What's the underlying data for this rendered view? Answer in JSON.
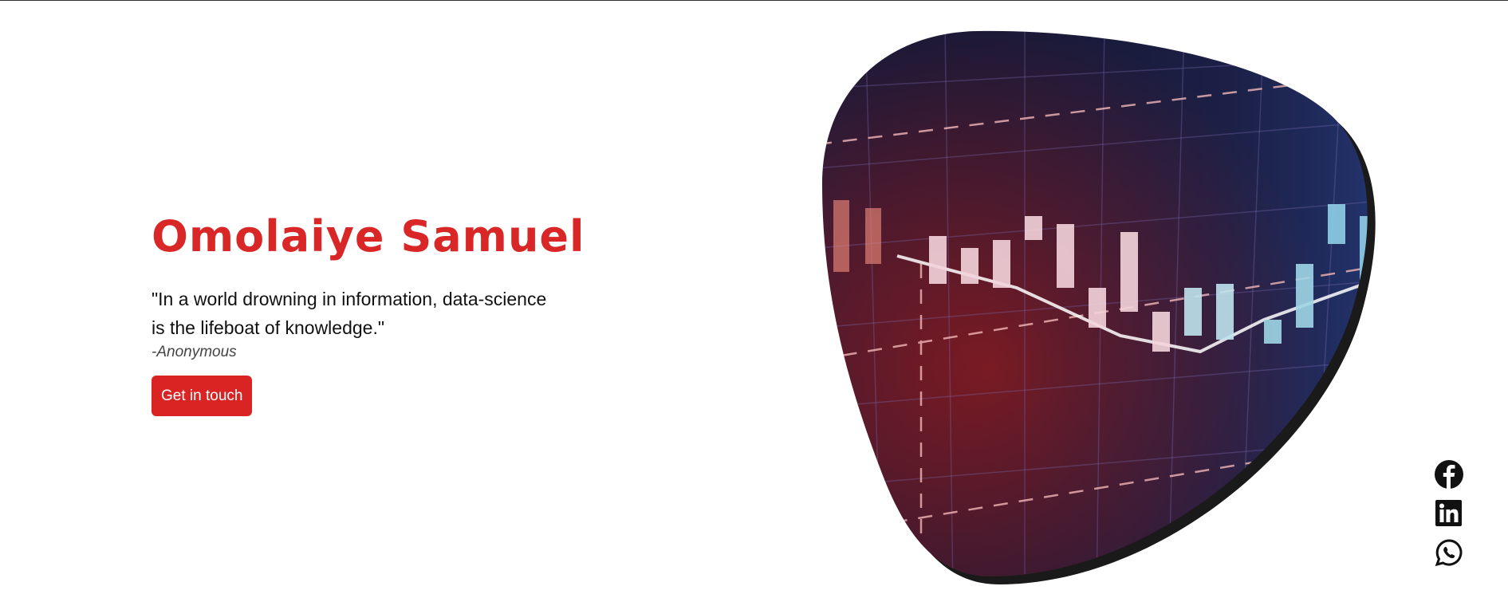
{
  "hero": {
    "name": "Omolaiye Samuel",
    "quote_line1": "\"In a world drowning in information, data-science",
    "quote_line2": "is the lifeboat of knowledge.\"",
    "author": "-Anonymous",
    "cta_label": "Get in touch"
  },
  "social": [
    {
      "icon": "facebook-icon"
    },
    {
      "icon": "linkedin-icon"
    },
    {
      "icon": "whatsapp-icon"
    }
  ],
  "colors": {
    "accent": "#da2424",
    "text": "#111111"
  }
}
